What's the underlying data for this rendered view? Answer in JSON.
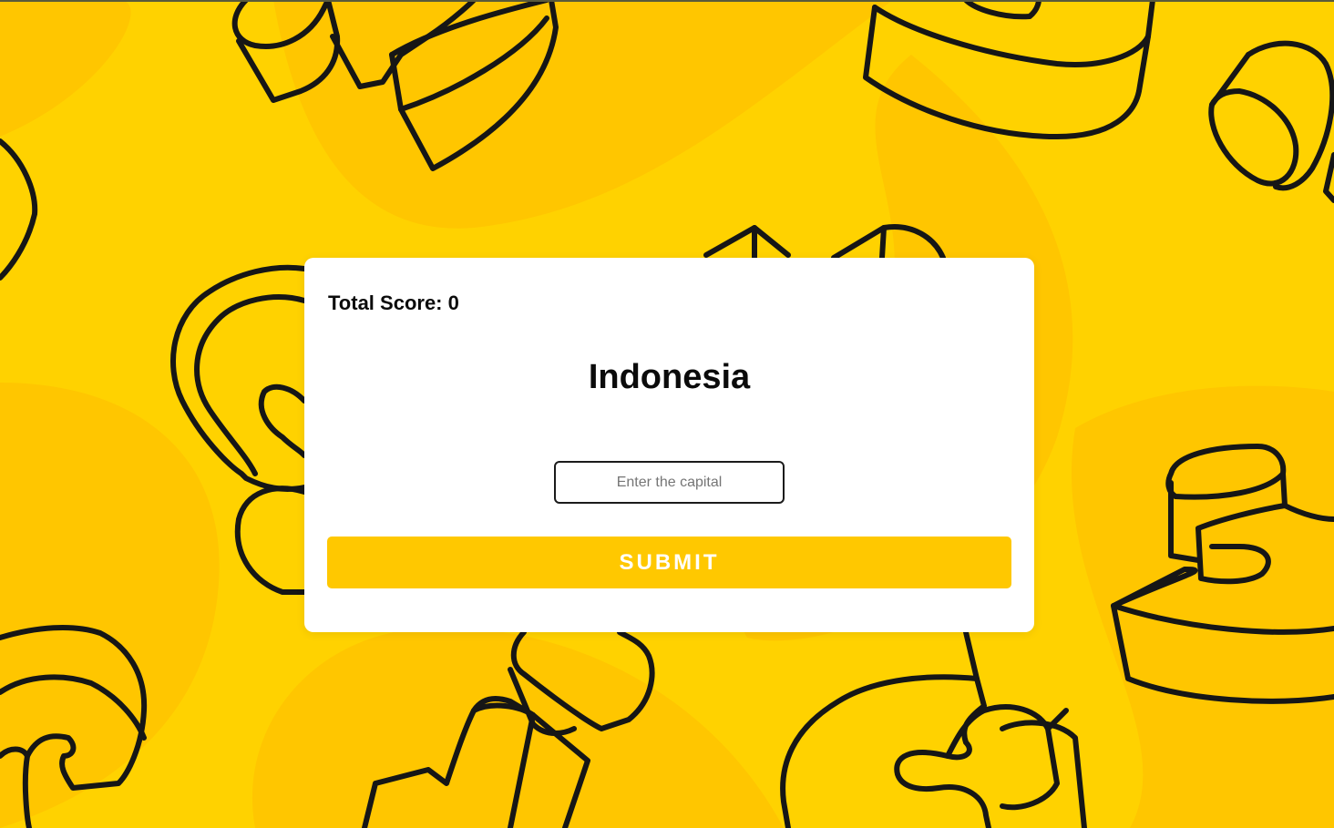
{
  "quiz": {
    "score_text": "Total Score: 0",
    "country": "Indonesia",
    "capital_placeholder": "Enter the capital",
    "submit_label": "SUBMIT"
  },
  "theme": {
    "background": "#ffd200",
    "background_blobs": "#ffc600",
    "button": "#ffc800",
    "card": "#ffffff"
  },
  "decorations": [
    "doodle-3d-letters-background"
  ]
}
